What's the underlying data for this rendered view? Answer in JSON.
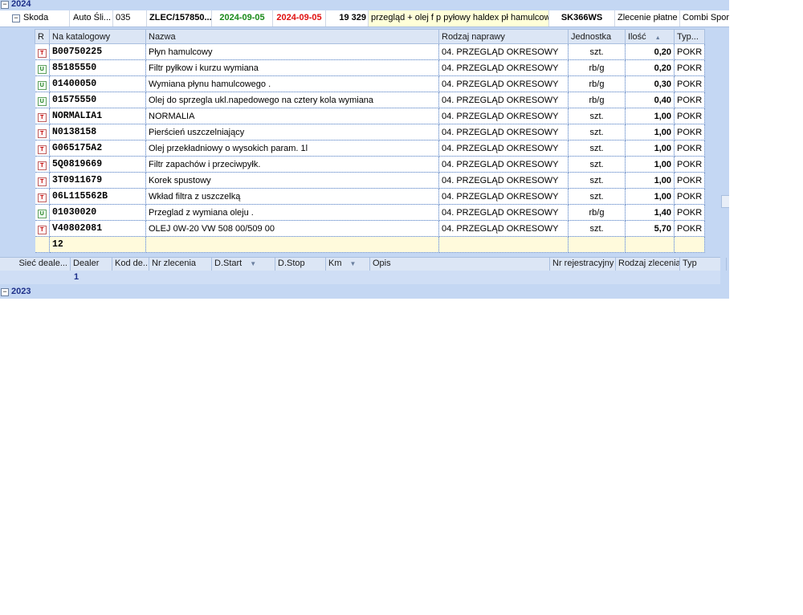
{
  "groups": [
    {
      "year": "2024",
      "toggle": "−"
    },
    {
      "year": "2023",
      "toggle": "−"
    }
  ],
  "order": {
    "toggle": "−",
    "brand": "Skoda",
    "dealer": "Auto Śli...",
    "code": "035",
    "number": "ZLEC/157850...",
    "date_start": "2024-09-05",
    "date_stop": "2024-09-05",
    "km": "19 329",
    "description": "przegląd + olej f p pyłowy haldex pł hamulcowy",
    "registration": "SK366WS",
    "order_type": "Zlecenie płatne",
    "type": "Combi Sport..."
  },
  "colors": {
    "date_start": "#1a8a1a",
    "date_stop": "#e01010",
    "description_bg": "#ffffd8",
    "footer_bg": "#fffadc"
  },
  "detail": {
    "headers": {
      "r": "R",
      "catalog": "Na katalogowy",
      "name": "Nazwa",
      "repair": "Rodzaj naprawy",
      "unit": "Jednostka",
      "qty": "Ilość",
      "typ": "Typ..."
    },
    "rows": [
      {
        "icon": "T",
        "catalog": "B00750225",
        "name": "Płyn hamulcowy",
        "repair": "04. PRZEGLĄD OKRESOWY",
        "unit": "szt.",
        "qty": "0,20",
        "typ": "POKR"
      },
      {
        "icon": "U",
        "catalog": "85185550",
        "name": "Filtr pyłkow i kurzu wymiana",
        "repair": "04. PRZEGLĄD OKRESOWY",
        "unit": "rb/g",
        "qty": "0,20",
        "typ": "POKR"
      },
      {
        "icon": "U",
        "catalog": "01400050",
        "name": "Wymiana płynu hamulcowego .",
        "repair": "04. PRZEGLĄD OKRESOWY",
        "unit": "rb/g",
        "qty": "0,30",
        "typ": "POKR"
      },
      {
        "icon": "U",
        "catalog": "01575550",
        "name": "Olej do sprzegla ukl.napedowego na cztery kola wymiana",
        "repair": "04. PRZEGLĄD OKRESOWY",
        "unit": "rb/g",
        "qty": "0,40",
        "typ": "POKR"
      },
      {
        "icon": "T",
        "catalog": "NORMALIA1",
        "name": "NORMALIA",
        "repair": "04. PRZEGLĄD OKRESOWY",
        "unit": "szt.",
        "qty": "1,00",
        "typ": "POKR"
      },
      {
        "icon": "T",
        "catalog": "N0138158",
        "name": "Pierścień uszczelniający",
        "repair": "04. PRZEGLĄD OKRESOWY",
        "unit": "szt.",
        "qty": "1,00",
        "typ": "POKR"
      },
      {
        "icon": "T",
        "catalog": "G065175A2",
        "name": "Olej przekładniowy o wysokich param. 1l",
        "repair": "04. PRZEGLĄD OKRESOWY",
        "unit": "szt.",
        "qty": "1,00",
        "typ": "POKR"
      },
      {
        "icon": "T",
        "catalog": "5Q0819669",
        "name": "Filtr zapachów i przeciwpyłk.",
        "repair": "04. PRZEGLĄD OKRESOWY",
        "unit": "szt.",
        "qty": "1,00",
        "typ": "POKR"
      },
      {
        "icon": "T",
        "catalog": "3T0911679",
        "name": "Korek spustowy",
        "repair": "04. PRZEGLĄD OKRESOWY",
        "unit": "szt.",
        "qty": "1,00",
        "typ": "POKR"
      },
      {
        "icon": "T",
        "catalog": "06L115562B",
        "name": "Wkład filtra z uszczelką",
        "repair": "04. PRZEGLĄD OKRESOWY",
        "unit": "szt.",
        "qty": "1,00",
        "typ": "POKR"
      },
      {
        "icon": "U",
        "catalog": "01030020",
        "name": "Przeglad z wymiana oleju .",
        "repair": "04. PRZEGLĄD OKRESOWY",
        "unit": "rb/g",
        "qty": "1,40",
        "typ": "POKR"
      },
      {
        "icon": "T",
        "catalog": "V40802081",
        "name": "OLEJ 0W-20 VW 508 00/509 00",
        "repair": "04. PRZEGLĄD OKRESOWY",
        "unit": "szt.",
        "qty": "5,70",
        "typ": "POKR"
      }
    ],
    "footer_count": "12",
    "sort_indicator": "▲"
  },
  "orders_header": {
    "columns": [
      "Sieć deale...",
      "Dealer",
      "Kod de...",
      "Nr zlecenia",
      "D.Start",
      "D.Stop",
      "Km",
      "Opis",
      "Nr rejestracyjny",
      "Rodzaj zlecenia",
      "Typ"
    ],
    "dropdown_glyph": "▼"
  },
  "orders_count": "1"
}
